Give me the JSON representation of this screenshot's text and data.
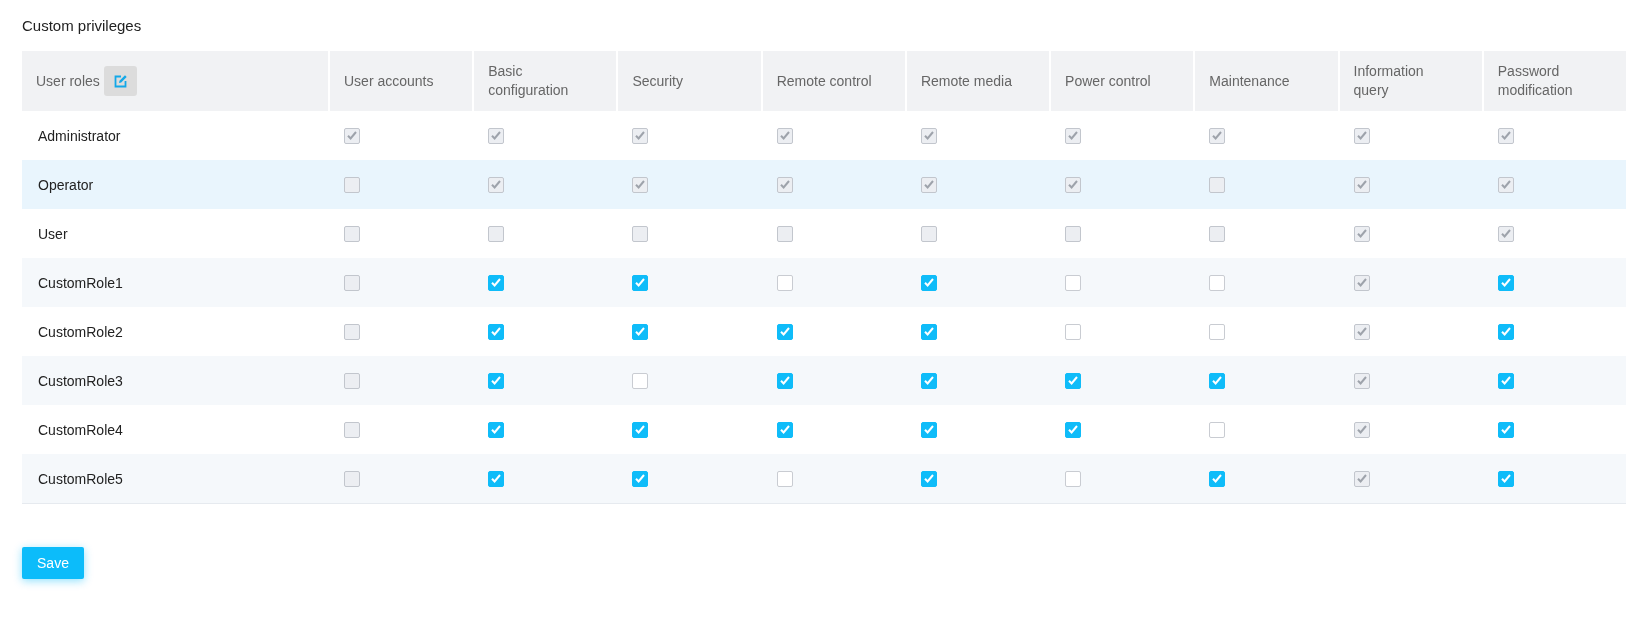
{
  "title": "Custom privileges",
  "table": {
    "role_column": {
      "label": "User roles"
    },
    "columns": [
      "User accounts",
      "Basic configuration",
      "Security",
      "Remote control",
      "Remote media",
      "Power control",
      "Maintenance",
      "Information query",
      "Password modification"
    ],
    "rows": [
      {
        "name": "Administrator",
        "highlighted": false,
        "cells": [
          {
            "checked": true,
            "disabled": true
          },
          {
            "checked": true,
            "disabled": true
          },
          {
            "checked": true,
            "disabled": true
          },
          {
            "checked": true,
            "disabled": true
          },
          {
            "checked": true,
            "disabled": true
          },
          {
            "checked": true,
            "disabled": true
          },
          {
            "checked": true,
            "disabled": true
          },
          {
            "checked": true,
            "disabled": true
          },
          {
            "checked": true,
            "disabled": true
          }
        ]
      },
      {
        "name": "Operator",
        "highlighted": true,
        "cells": [
          {
            "checked": false,
            "disabled": true
          },
          {
            "checked": true,
            "disabled": true
          },
          {
            "checked": true,
            "disabled": true
          },
          {
            "checked": true,
            "disabled": true
          },
          {
            "checked": true,
            "disabled": true
          },
          {
            "checked": true,
            "disabled": true
          },
          {
            "checked": false,
            "disabled": true
          },
          {
            "checked": true,
            "disabled": true
          },
          {
            "checked": true,
            "disabled": true
          }
        ]
      },
      {
        "name": "User",
        "highlighted": false,
        "cells": [
          {
            "checked": false,
            "disabled": true
          },
          {
            "checked": false,
            "disabled": true
          },
          {
            "checked": false,
            "disabled": true
          },
          {
            "checked": false,
            "disabled": true
          },
          {
            "checked": false,
            "disabled": true
          },
          {
            "checked": false,
            "disabled": true
          },
          {
            "checked": false,
            "disabled": true
          },
          {
            "checked": true,
            "disabled": true
          },
          {
            "checked": true,
            "disabled": true
          }
        ]
      },
      {
        "name": "CustomRole1",
        "highlighted": false,
        "cells": [
          {
            "checked": false,
            "disabled": true
          },
          {
            "checked": true,
            "disabled": false
          },
          {
            "checked": true,
            "disabled": false
          },
          {
            "checked": false,
            "disabled": false
          },
          {
            "checked": true,
            "disabled": false
          },
          {
            "checked": false,
            "disabled": false
          },
          {
            "checked": false,
            "disabled": false
          },
          {
            "checked": true,
            "disabled": true
          },
          {
            "checked": true,
            "disabled": false
          }
        ]
      },
      {
        "name": "CustomRole2",
        "highlighted": false,
        "cells": [
          {
            "checked": false,
            "disabled": true
          },
          {
            "checked": true,
            "disabled": false
          },
          {
            "checked": true,
            "disabled": false
          },
          {
            "checked": true,
            "disabled": false
          },
          {
            "checked": true,
            "disabled": false
          },
          {
            "checked": false,
            "disabled": false
          },
          {
            "checked": false,
            "disabled": false
          },
          {
            "checked": true,
            "disabled": true
          },
          {
            "checked": true,
            "disabled": false
          }
        ]
      },
      {
        "name": "CustomRole3",
        "highlighted": false,
        "cells": [
          {
            "checked": false,
            "disabled": true
          },
          {
            "checked": true,
            "disabled": false
          },
          {
            "checked": false,
            "disabled": false
          },
          {
            "checked": true,
            "disabled": false
          },
          {
            "checked": true,
            "disabled": false
          },
          {
            "checked": true,
            "disabled": false
          },
          {
            "checked": true,
            "disabled": false
          },
          {
            "checked": true,
            "disabled": true
          },
          {
            "checked": true,
            "disabled": false
          }
        ]
      },
      {
        "name": "CustomRole4",
        "highlighted": false,
        "cells": [
          {
            "checked": false,
            "disabled": true
          },
          {
            "checked": true,
            "disabled": false
          },
          {
            "checked": true,
            "disabled": false
          },
          {
            "checked": true,
            "disabled": false
          },
          {
            "checked": true,
            "disabled": false
          },
          {
            "checked": true,
            "disabled": false
          },
          {
            "checked": false,
            "disabled": false
          },
          {
            "checked": true,
            "disabled": true
          },
          {
            "checked": true,
            "disabled": false
          }
        ]
      },
      {
        "name": "CustomRole5",
        "highlighted": false,
        "cells": [
          {
            "checked": false,
            "disabled": true
          },
          {
            "checked": true,
            "disabled": false
          },
          {
            "checked": true,
            "disabled": false
          },
          {
            "checked": false,
            "disabled": false
          },
          {
            "checked": true,
            "disabled": false
          },
          {
            "checked": false,
            "disabled": false
          },
          {
            "checked": true,
            "disabled": false
          },
          {
            "checked": true,
            "disabled": true
          },
          {
            "checked": true,
            "disabled": false
          }
        ]
      }
    ]
  },
  "save_button": {
    "label": "Save"
  }
}
